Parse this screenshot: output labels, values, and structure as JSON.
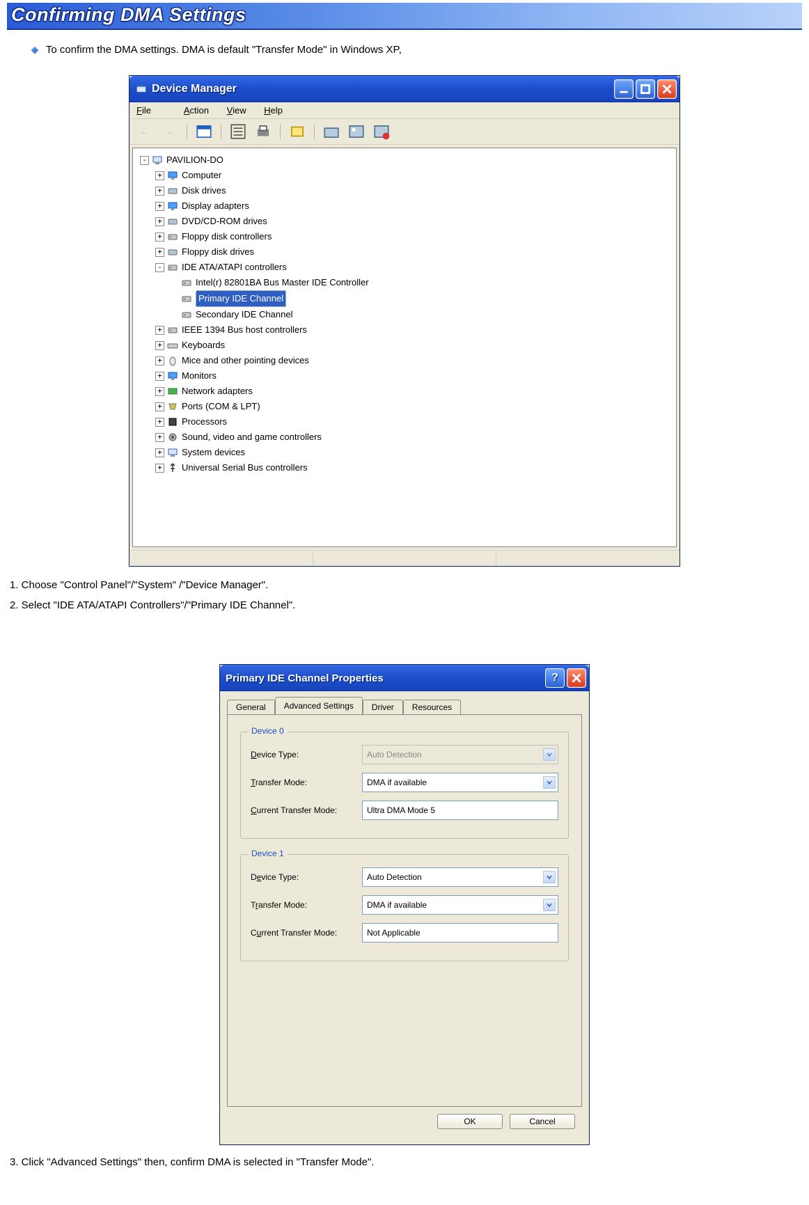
{
  "page": {
    "title": "Confirming DMA Settings"
  },
  "intro": "To confirm the DMA settings. DMA  is default \"Transfer Mode\" in Windows XP,",
  "dm": {
    "title": "Device Manager",
    "menu": {
      "file": "File",
      "action": "Action",
      "view": "View",
      "help": "Help"
    },
    "root": "PAVILION-DO",
    "nodes": [
      "Computer",
      "Disk drives",
      "Display adapters",
      "DVD/CD-ROM drives",
      "Floppy disk controllers",
      "Floppy disk drives",
      "IDE ATA/ATAPI controllers"
    ],
    "ide": {
      "c0": "Intel(r) 82801BA Bus Master IDE Controller",
      "c1": "Primary IDE Channel",
      "c2": "Secondary IDE Channel"
    },
    "nodes2": [
      "IEEE 1394 Bus host controllers",
      "Keyboards",
      "Mice and other pointing devices",
      "Monitors",
      "Network adapters",
      "Ports (COM & LPT)",
      "Processors",
      "Sound, video and game controllers",
      "System devices",
      "Universal Serial Bus controllers"
    ]
  },
  "step1": "1. Choose \"Control Panel\"/\"System\" /\"Device Manager\".",
  "step2": "2. Select \"IDE ATA/ATAPI Controllers\"/\"Primary IDE Channel\".",
  "step3": "3. Click \"Advanced Settings\" then, confirm DMA  is selected in \"Transfer Mode\".",
  "props": {
    "title": "Primary IDE Channel Properties",
    "tabs": {
      "general": "General",
      "adv": "Advanced Settings",
      "driver": "Driver",
      "res": "Resources"
    },
    "g0": {
      "title": "Device 0",
      "devtype_l": "Device Type:",
      "devtype_v": "Auto Detection",
      "tm_l": "Transfer Mode:",
      "tm_v": "DMA if available",
      "ctm_l": "Current Transfer Mode:",
      "ctm_v": "Ultra DMA Mode 5"
    },
    "g1": {
      "title": "Device 1",
      "devtype_l": "Device Type:",
      "devtype_v": "Auto Detection",
      "tm_l": "Transfer Mode:",
      "tm_v": "DMA if available",
      "ctm_l": "Current Transfer Mode:",
      "ctm_v": "Not Applicable"
    },
    "ok": "OK",
    "cancel": "Cancel"
  }
}
